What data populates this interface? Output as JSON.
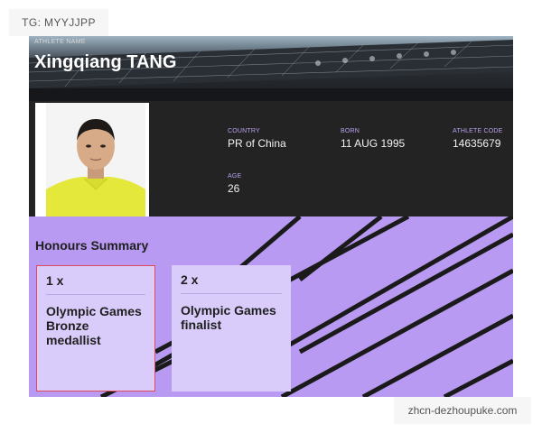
{
  "watermarks": {
    "tag": "TG: MYYJJPP",
    "site": "zhcn-dezhoupuke.com"
  },
  "header": {
    "label": "ATHLETE NAME",
    "name": "Xingqiang TANG"
  },
  "profile": {
    "fields": [
      {
        "label": "COUNTRY",
        "value": "PR of China"
      },
      {
        "label": "BORN",
        "value": "11 AUG 1995"
      },
      {
        "label": "ATHLETE CODE",
        "value": "14635679"
      },
      {
        "label": "AGE",
        "value": "26"
      }
    ]
  },
  "honours": {
    "title": "Honours Summary",
    "cards": [
      {
        "count": "1 x",
        "description": "Olympic Games Bronze medallist"
      },
      {
        "count": "2 x",
        "description": "Olympic Games finalist"
      }
    ]
  },
  "colors": {
    "accent_purple": "#b89af2",
    "card_bg": "#d9ccfa",
    "label_purple": "#b9a2ee",
    "dark": "#232323",
    "selection_red": "#e24a5b"
  }
}
